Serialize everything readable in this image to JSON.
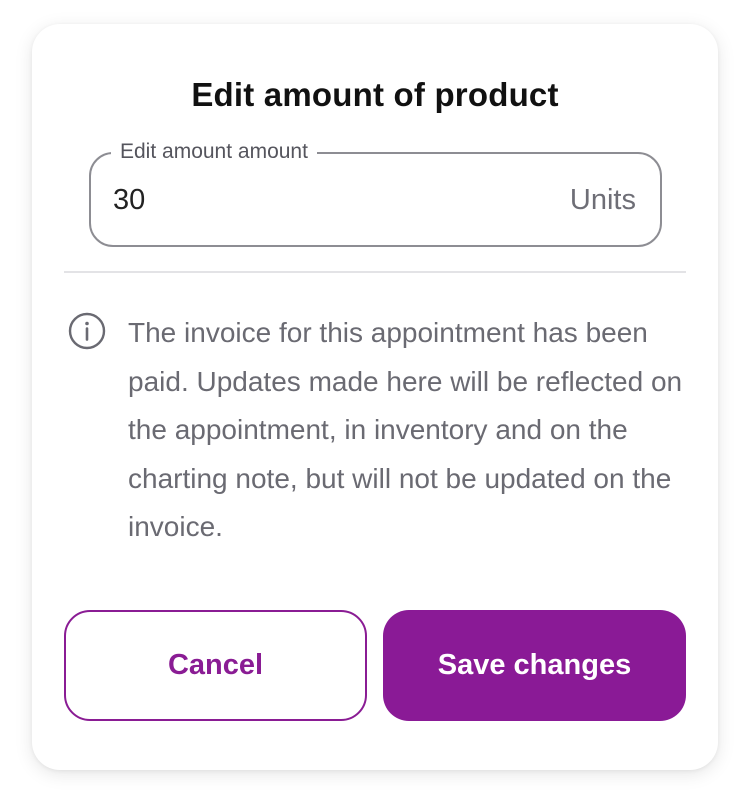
{
  "dialog": {
    "title": "Edit amount of product"
  },
  "amount_field": {
    "label": "Edit amount amount",
    "value": "30",
    "unit": "Units"
  },
  "notice": {
    "icon": "info-circle-icon",
    "text": "The invoice for this appointment has been paid. Updates made here will be reflected on the appointment, in inventory and on the charting note, but will not be updated on the invoice."
  },
  "actions": {
    "cancel_label": "Cancel",
    "save_label": "Save changes"
  },
  "colors": {
    "accent": "#8a1a96",
    "title_text": "#111111",
    "body_text": "#6a6a72",
    "field_border": "#8d8d93"
  }
}
